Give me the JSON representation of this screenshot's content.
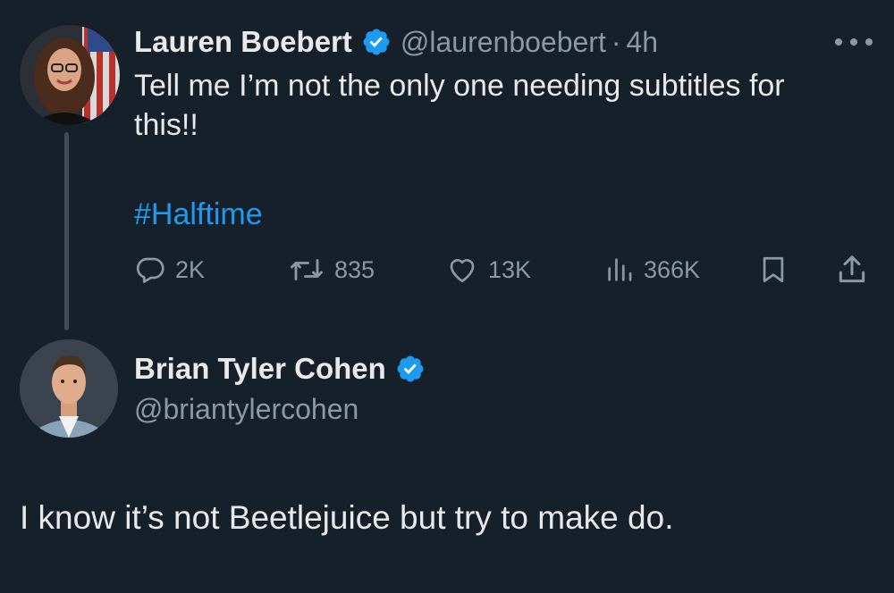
{
  "tweet": {
    "author_name": "Lauren Boebert",
    "handle": "@laurenboebert",
    "separator": "·",
    "time": "4h",
    "text": "Tell me I’m not the only one needing subtitles for\nthis!!",
    "hashtag": "#Halftime",
    "stats": {
      "replies": "2K",
      "reposts": "835",
      "likes": "13K",
      "views": "366K"
    }
  },
  "reply": {
    "author_name": "Brian Tyler Cohen",
    "handle": "@briantylercohen",
    "text": "I know it’s not Beetlejuice but try to make do."
  },
  "colors": {
    "background": "#15202b",
    "primary_text": "#e7e9ea",
    "secondary_text": "#8b98a5",
    "link": "#1d9bf0",
    "verified_badge": "#1d9bf0"
  },
  "icons": {
    "more": "more-horizontal-icon",
    "verified": "verified-badge-icon",
    "reply": "reply-icon",
    "repost": "repost-icon",
    "like": "heart-icon",
    "views": "views-chart-icon",
    "bookmark": "bookmark-icon",
    "share": "share-icon"
  }
}
